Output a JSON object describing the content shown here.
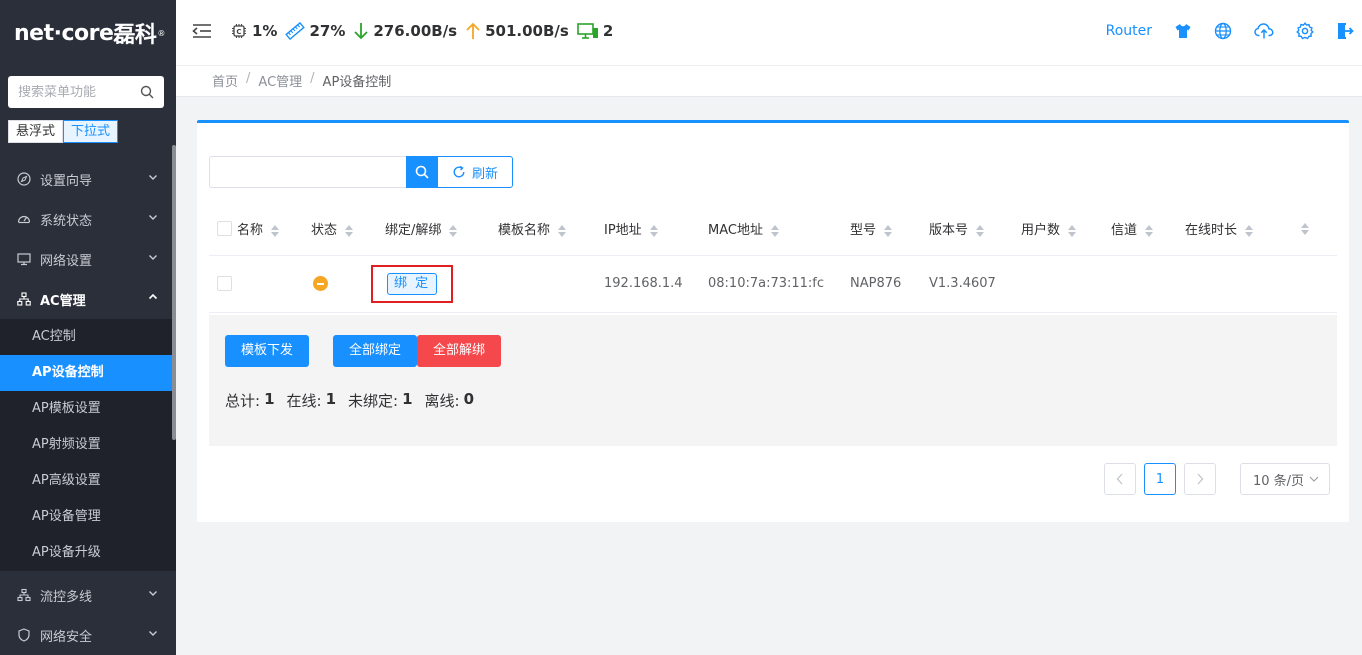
{
  "app": {
    "logo_text": "net·core",
    "logo_cn": "磊科",
    "logo_reg": "®"
  },
  "sidebar": {
    "search_placeholder": "搜索菜单功能",
    "modes": [
      "悬浮式",
      "下拉式"
    ],
    "items": [
      {
        "label": "设置向导",
        "icon": "compass-icon"
      },
      {
        "label": "系统状态",
        "icon": "gauge-icon"
      },
      {
        "label": "网络设置",
        "icon": "monitor-icon"
      },
      {
        "label": "AC管理",
        "icon": "network-tree-icon"
      },
      {
        "label": "流控多线",
        "icon": "flow-icon"
      },
      {
        "label": "网络安全",
        "icon": "shield-icon"
      }
    ],
    "sub_items": [
      "AC控制",
      "AP设备控制",
      "AP模板设置",
      "AP射频设置",
      "AP高级设置",
      "AP设备管理",
      "AP设备升级"
    ]
  },
  "header": {
    "cpu": "1%",
    "mem": "27%",
    "down": "276.00B/s",
    "up": "501.00B/s",
    "devices": "2",
    "router_label": "Router",
    "colors": {
      "down": "#2aa52a",
      "up": "#f5a623",
      "device": "#2aa52a",
      "accent": "#1890ff"
    }
  },
  "breadcrumb": [
    "首页",
    "AC管理",
    "AP设备控制"
  ],
  "toolbar": {
    "search_value": "",
    "refresh_label": "刷新"
  },
  "table": {
    "columns": [
      "名称",
      "状态",
      "绑定/解绑",
      "模板名称",
      "IP地址",
      "MAC地址",
      "型号",
      "版本号",
      "用户数",
      "信道",
      "在线时长"
    ],
    "rows": [
      {
        "name": "",
        "status": "offline-warning",
        "bind_label": "绑 定",
        "template": "",
        "ip": "192.168.1.4",
        "mac": "08:10:7a:73:11:fc",
        "model": "NAP876",
        "version": "V1.3.4607",
        "users": "",
        "channel": "",
        "uptime": ""
      }
    ]
  },
  "actions": {
    "template_push": "模板下发",
    "bind_all": "全部绑定",
    "unbind_all": "全部解绑"
  },
  "summary": {
    "total_label": "总计:",
    "total": "1",
    "online_label": "在线:",
    "online": "1",
    "unbound_label": "未绑定:",
    "unbound": "1",
    "offline_label": "离线:",
    "offline": "0"
  },
  "pagination": {
    "current": "1",
    "page_size": "10 条/页"
  }
}
